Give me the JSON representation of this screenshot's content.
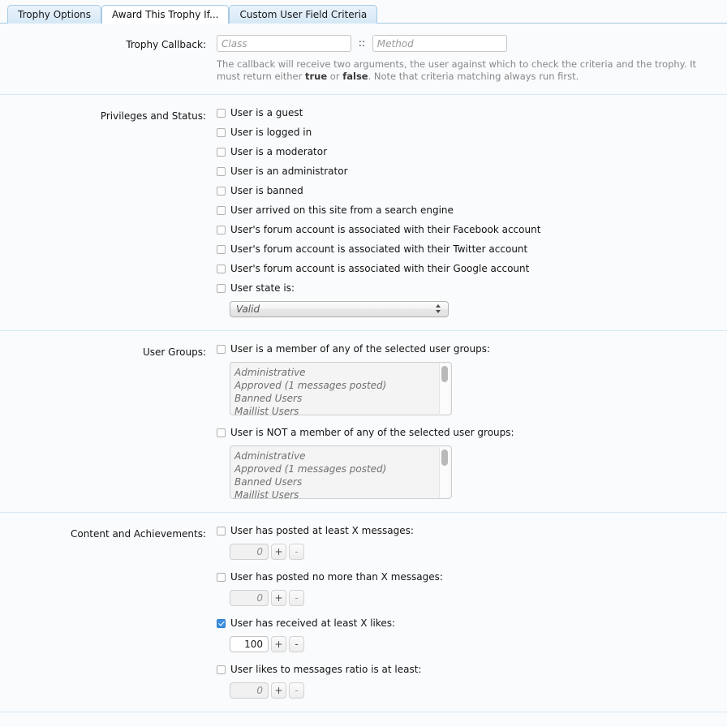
{
  "tabs": [
    {
      "label": "Trophy Options",
      "active": false
    },
    {
      "label": "Award This Trophy If...",
      "active": true
    },
    {
      "label": "Custom User Field Criteria",
      "active": false
    }
  ],
  "callback": {
    "label": "Trophy Callback:",
    "class_placeholder": "Class",
    "class_value": "",
    "separator": "::",
    "method_placeholder": "Method",
    "method_value": "",
    "help_part1": "The callback will receive two arguments, the user against which to check the criteria and the trophy. It must return either ",
    "help_true": "true",
    "help_or": " or ",
    "help_false": "false",
    "help_part2": ". Note that criteria matching always run first."
  },
  "privileges": {
    "label": "Privileges and Status:",
    "items": [
      {
        "label": "User is a guest",
        "checked": false
      },
      {
        "label": "User is logged in",
        "checked": false
      },
      {
        "label": "User is a moderator",
        "checked": false
      },
      {
        "label": "User is an administrator",
        "checked": false
      },
      {
        "label": "User is banned",
        "checked": false
      },
      {
        "label": "User arrived on this site from a search engine",
        "checked": false
      },
      {
        "label": "User's forum account is associated with their Facebook account",
        "checked": false
      },
      {
        "label": "User's forum account is associated with their Twitter account",
        "checked": false
      },
      {
        "label": "User's forum account is associated with their Google account",
        "checked": false
      },
      {
        "label": "User state is:",
        "checked": false
      }
    ],
    "state_select_value": "Valid"
  },
  "user_groups": {
    "label": "User Groups:",
    "member_label": "User is a member of any of the selected user groups:",
    "member_checked": false,
    "member_options": [
      "Administrative",
      "Approved (1 messages posted)",
      "Banned Users",
      "Maillist Users"
    ],
    "not_member_label": "User is NOT a member of any of the selected user groups:",
    "not_member_checked": false,
    "not_member_options": [
      "Administrative",
      "Approved (1 messages posted)",
      "Banned Users",
      "Maillist Users"
    ]
  },
  "content": {
    "label": "Content and Achievements:",
    "items": [
      {
        "label": "User has posted at least X messages:",
        "checked": false,
        "value": "0",
        "plus": "+",
        "minus": "-",
        "filled": false
      },
      {
        "label": "User has posted no more than X messages:",
        "checked": false,
        "value": "0",
        "plus": "+",
        "minus": "-",
        "filled": false
      },
      {
        "label": "User has received at least X likes:",
        "checked": true,
        "value": "100",
        "plus": "+",
        "minus": "-",
        "filled": true
      },
      {
        "label": "User likes to messages ratio is at least:",
        "checked": false,
        "value": "0",
        "plus": "+",
        "minus": "-",
        "filled": false
      }
    ]
  },
  "colors": {
    "accent": "#3b8fe0",
    "tab_border": "#a5cae4",
    "section_divider": "#d4e8f7",
    "page_bg": "#fafbfd"
  }
}
